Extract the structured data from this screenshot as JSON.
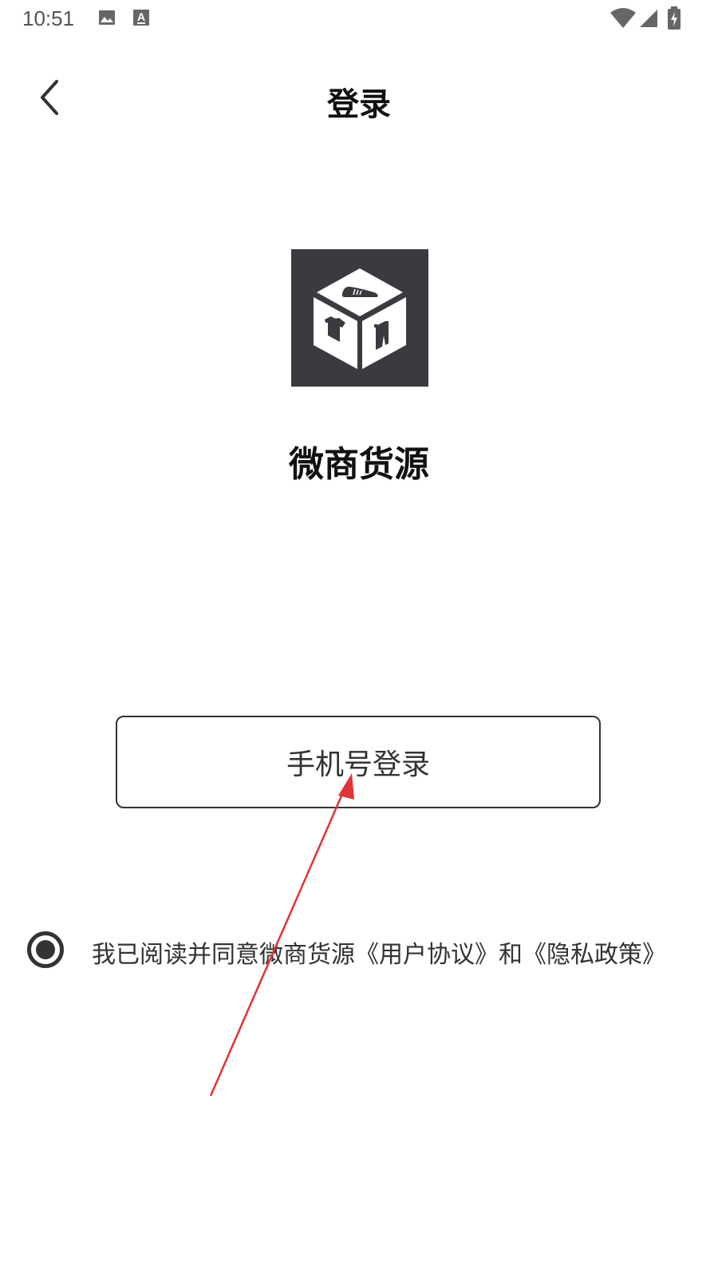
{
  "status_bar": {
    "time": "10:51",
    "icons": [
      "image-icon",
      "text-a-icon",
      "wifi-icon",
      "signal-icon",
      "battery-charging-icon"
    ]
  },
  "header": {
    "title": "登录",
    "back_icon": "chevron-left-icon"
  },
  "app": {
    "name": "微商货源",
    "logo_icon": "product-cube-logo"
  },
  "login": {
    "phone_button_label": "手机号登录"
  },
  "agreement": {
    "checked": true,
    "prefix": "我已阅读并同意微商货源",
    "user_agreement": "《用户协议》",
    "conjunction": "和",
    "privacy_policy": "《隐私政策》"
  },
  "colors": {
    "logo_bg": "#3b3a3f",
    "annotation_arrow": "#e0333a",
    "text": "#333333"
  }
}
